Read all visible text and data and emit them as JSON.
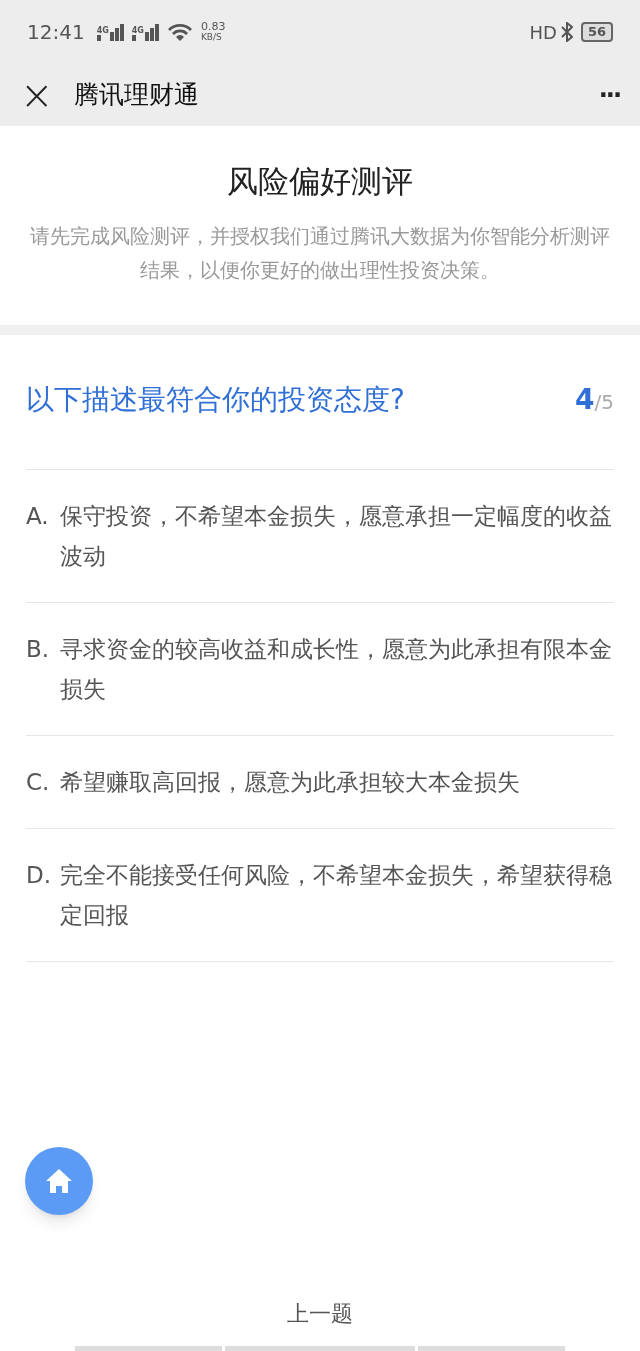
{
  "status_bar": {
    "time": "12:41",
    "network_labels": [
      "4G",
      "4G"
    ],
    "speed_value": "0.83",
    "speed_unit": "KB/S",
    "hd": "HD",
    "battery": "56"
  },
  "nav": {
    "close": "×",
    "title": "腾讯理财通",
    "more": "···"
  },
  "header": {
    "title": "风险偏好测评",
    "description": "请先完成风险测评，并授权我们通过腾讯大数据为你智能分析测评结果，以便你更好的做出理性投资决策。"
  },
  "question": {
    "text": "以下描述最符合你的投资态度?",
    "current": "4",
    "total": "/5"
  },
  "options": [
    {
      "letter": "A.",
      "text": "保守投资，不希望本金损失，愿意承担一定幅度的收益波动"
    },
    {
      "letter": "B.",
      "text": "寻求资金的较高收益和成长性，愿意为此承担有限本金损失"
    },
    {
      "letter": "C.",
      "text": "希望赚取高回报，愿意为此承担较大本金损失"
    },
    {
      "letter": "D.",
      "text": "完全不能接受任何风险，不希望本金损失，希望获得稳定回报"
    }
  ],
  "prev_button": "上一题"
}
